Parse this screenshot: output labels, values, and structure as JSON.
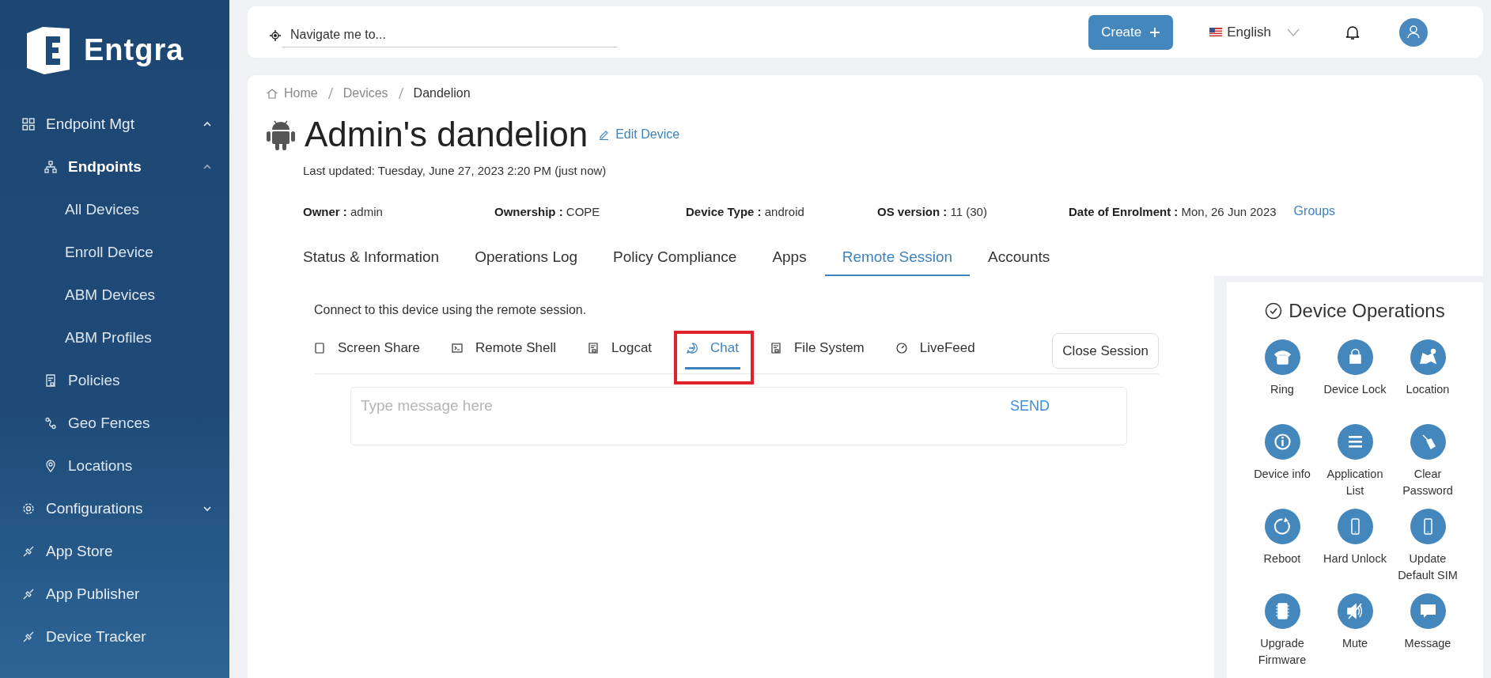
{
  "sidebar": {
    "logo_text": "Entgra",
    "items": [
      {
        "label": "Endpoint Mgt",
        "expanded": true,
        "children": [
          {
            "label": "Endpoints",
            "expanded": true,
            "children": [
              {
                "label": "All Devices"
              },
              {
                "label": "Enroll Device"
              },
              {
                "label": "ABM Devices"
              },
              {
                "label": "ABM Profiles"
              }
            ]
          },
          {
            "label": "Policies"
          },
          {
            "label": "Geo Fences"
          },
          {
            "label": "Locations"
          }
        ]
      },
      {
        "label": "Configurations",
        "expanded": false
      },
      {
        "label": "App Store"
      },
      {
        "label": "App Publisher"
      },
      {
        "label": "Device Tracker"
      }
    ]
  },
  "topbar": {
    "search": {
      "placeholder": "Navigate me to..."
    },
    "create_button": "Create",
    "language": "English"
  },
  "breadcrumb": [
    "Home",
    "Devices",
    "Dandelion"
  ],
  "device": {
    "title": "Admin's dandelion",
    "edit_link": "Edit Device",
    "last_updated": "Last updated: Tuesday, June 27, 2023 2:20 PM (just now)",
    "properties": [
      {
        "label": "Owner :",
        "value": "admin"
      },
      {
        "label": "Ownership :",
        "value": "COPE"
      },
      {
        "label": "Device Type :",
        "value": "android"
      },
      {
        "label": "OS version :",
        "value": "11 (30)"
      },
      {
        "label": "Date of Enrolment :",
        "value": "Mon, 26 Jun 2023"
      }
    ],
    "groups_link": "Groups"
  },
  "tabs": [
    {
      "label": "Status & Information",
      "selected": false
    },
    {
      "label": "Operations Log",
      "selected": false
    },
    {
      "label": "Policy Compliance",
      "selected": false
    },
    {
      "label": "Apps",
      "selected": false
    },
    {
      "label": "Remote Session",
      "selected": true
    },
    {
      "label": "Accounts",
      "selected": false
    }
  ],
  "remote_session": {
    "intro": "Connect to this device using the remote session.",
    "tabs": [
      {
        "label": "Screen Share",
        "selected": false
      },
      {
        "label": "Remote Shell",
        "selected": false
      },
      {
        "label": "Logcat",
        "selected": false
      },
      {
        "label": "Chat",
        "selected": true
      },
      {
        "label": "File System",
        "selected": false
      },
      {
        "label": "LiveFeed",
        "selected": false
      }
    ],
    "close_button": "Close Session",
    "chat": {
      "placeholder": "Type message here",
      "send": "SEND"
    }
  },
  "operations": {
    "title": "Device Operations",
    "items": [
      {
        "label": "Ring"
      },
      {
        "label": "Device Lock"
      },
      {
        "label": "Location"
      },
      {
        "label": "Device info"
      },
      {
        "label": "Application List"
      },
      {
        "label": "Clear Password"
      },
      {
        "label": "Reboot"
      },
      {
        "label": "Hard Unlock"
      },
      {
        "label": "Update Default SIM"
      },
      {
        "label": "Upgrade Firmware"
      },
      {
        "label": "Mute"
      },
      {
        "label": "Message"
      }
    ]
  }
}
